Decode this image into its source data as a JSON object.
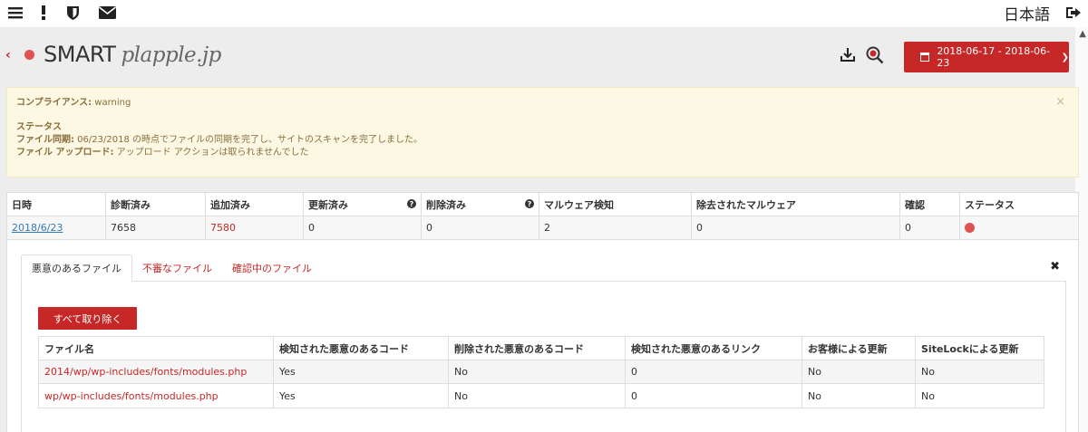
{
  "topbar": {
    "icons": [
      "menu-icon",
      "alert-icon",
      "shield-icon",
      "mail-icon",
      "logout-icon"
    ],
    "language": "日本語"
  },
  "header": {
    "title": "SMART",
    "site": "plapple.jp",
    "date_range": "2018-06-17 - 2018-06-23",
    "icons": [
      "back-chevron-icon",
      "download-icon",
      "magnify-target-icon",
      "calendar-icon",
      "chevron-down-icon"
    ]
  },
  "alert": {
    "compliance_label": "コンプライアンス:",
    "compliance_value": " warning",
    "status_heading": "ステータス",
    "sync_label": "ファイル同期:",
    "sync_value": " 06/23/2018 の時点でファイルの同期を完了し、サイトのスキャンを完了しました。",
    "upload_label": "ファイル アップロード:",
    "upload_value": " アップロード アクションは取られませんでした",
    "close": "×"
  },
  "summary": {
    "headers": [
      "日時",
      "診断済み",
      "追加済み",
      "更新済み",
      "削除済み",
      "マルウェア検知",
      "除去されたマルウェア",
      "確認",
      "ステータス"
    ],
    "row": {
      "date": "2018/6/23",
      "scanned": "7658",
      "added": "7580",
      "updated": "0",
      "deleted": "0",
      "malware": "2",
      "removed": "0",
      "confirmed": "0"
    },
    "status_color": "#e05252"
  },
  "detail": {
    "tabs": [
      "悪意のあるファイル",
      "不審なファイル",
      "確認中のファイル"
    ],
    "active_tab": 0,
    "close": "✖",
    "remove_all": "すべて取り除く",
    "columns": [
      "ファイル名",
      "検知された悪意のあるコード",
      "削除された悪意のあるコード",
      "検知された悪意のあるリンク",
      "お客様による更新",
      "SiteLockによる更新"
    ],
    "rows": [
      [
        "2014/wp/wp-includes/fonts/modules.php",
        "Yes",
        "No",
        "0",
        "No",
        "No"
      ],
      [
        "wp/wp-includes/fonts/modules.php",
        "Yes",
        "No",
        "0",
        "No",
        "No"
      ]
    ]
  },
  "colors": {
    "accent": "#c62828",
    "alert_bg": "#fcf8e3",
    "alert_text": "#8a6d3b",
    "link": "#337ab7"
  }
}
